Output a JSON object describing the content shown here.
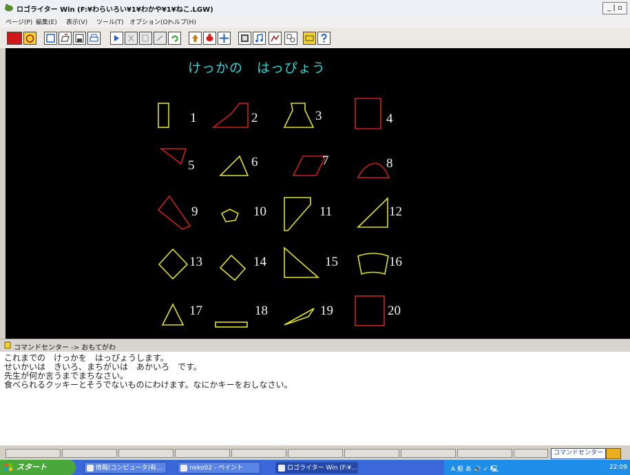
{
  "window": {
    "title": "ロゴライター Win (F:¥わらいろい¥1¥わかや¥1¥ねこ.LGW)",
    "controls": "_ | ▫"
  },
  "menu": {
    "items": [
      "ページ(P)",
      "編集(E)",
      "表示(V)",
      "ツール(T)",
      "オプション(O)",
      "ヘルプ(H)"
    ]
  },
  "colors": {
    "canvas_bg": "#000000",
    "title_text": "#2fd6d6",
    "shape_yellow": "#e3e32a",
    "shape_red": "#cc2020",
    "label_white": "#f4f4f4"
  },
  "canvas": {
    "title": "けっかの　はっぴょう",
    "shapes": [
      {
        "n": "1",
        "color": "yellow"
      },
      {
        "n": "2",
        "color": "red"
      },
      {
        "n": "3",
        "color": "yellow"
      },
      {
        "n": "4",
        "color": "red"
      },
      {
        "n": "5",
        "color": "red"
      },
      {
        "n": "6",
        "color": "yellow"
      },
      {
        "n": "7",
        "color": "red"
      },
      {
        "n": "8",
        "color": "red"
      },
      {
        "n": "9",
        "color": "red"
      },
      {
        "n": "10",
        "color": "yellow"
      },
      {
        "n": "11",
        "color": "yellow"
      },
      {
        "n": "12",
        "color": "yellow"
      },
      {
        "n": "13",
        "color": "yellow"
      },
      {
        "n": "14",
        "color": "yellow"
      },
      {
        "n": "15",
        "color": "yellow"
      },
      {
        "n": "16",
        "color": "yellow"
      },
      {
        "n": "17",
        "color": "yellow"
      },
      {
        "n": "18",
        "color": "yellow"
      },
      {
        "n": "19",
        "color": "yellow"
      },
      {
        "n": "20",
        "color": "red"
      }
    ]
  },
  "command_center": {
    "title": "コマンドセンター -> おもてがわ",
    "lines": [
      "これまでの　けっかを　はっぴょうします。",
      "せいかいは　きいろ、まちがいは　あかいろ　です。",
      "先生が何か言うまでまちなさい。",
      "食べられるクッキーとそうでないものにわけます。なにかキーをおしなさい。"
    ]
  },
  "status": {
    "label": "コマンドセンター"
  },
  "taskbar": {
    "start_label": "スタート",
    "tasks": [
      "情報(コンピュータ)有...",
      "neko02 - ペイント",
      "ロゴライター Win (F:¥..."
    ],
    "ime": "A 般 あ 🔊 ✓ 🖳",
    "clock": "22:09"
  }
}
